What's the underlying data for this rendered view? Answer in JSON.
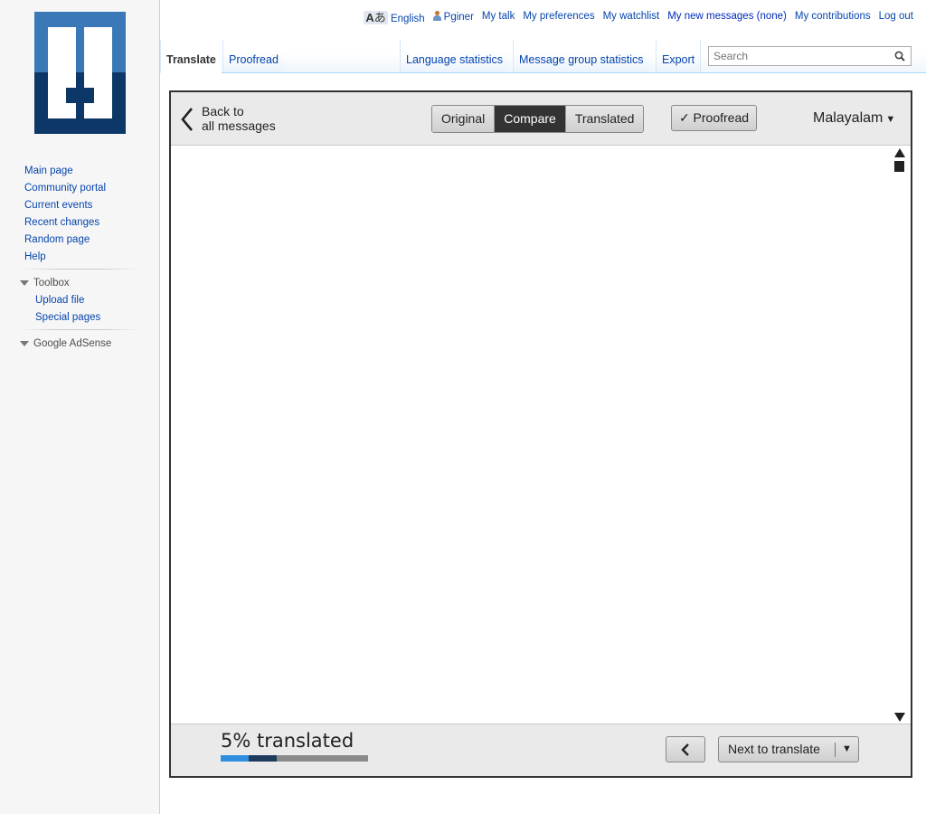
{
  "personal_tools": {
    "language": "English",
    "username": "Pginer",
    "my_talk": "My talk",
    "my_preferences": "My preferences",
    "my_watchlist": "My watchlist",
    "new_messages": "My new messages (none)",
    "my_contributions": "My contributions",
    "log_out": "Log out",
    "uls_glyph_latin": "A",
    "uls_glyph_japanese": "あ"
  },
  "tabs": {
    "translate": "Translate",
    "proofread": "Proofread",
    "language_statistics": "Language statistics",
    "message_group_statistics": "Message group statistics",
    "export": "Export"
  },
  "search": {
    "placeholder": "Search"
  },
  "navigation": {
    "items": [
      "Main page",
      "Community portal",
      "Current events",
      "Recent changes",
      "Random page",
      "Help"
    ]
  },
  "toolbox": {
    "heading": "Toolbox",
    "items": [
      "Upload file",
      "Special pages"
    ]
  },
  "adsense": {
    "heading": "Google AdSense"
  },
  "translate_panel": {
    "back_line1": "Back to",
    "back_line2": "all messages",
    "modes": [
      "Original",
      "Compare",
      "Translated"
    ],
    "active_mode": "Compare",
    "proofread_button": "✓ Proofread",
    "language": "Malayalam",
    "progress_label": "5% translated",
    "progress": {
      "segment1_fraction": 0.19,
      "segment2_fraction": 0.19
    },
    "next_button": "Next to translate",
    "dropdown_caret": "▼"
  },
  "colors": {
    "logo_light": "#3a78b8",
    "logo_dark": "#0c3766",
    "link": "#0645ad",
    "progress_translated": "#2f8ee0",
    "progress_proofread": "#1e3a5c",
    "progress_remaining": "#8a8a8a"
  }
}
